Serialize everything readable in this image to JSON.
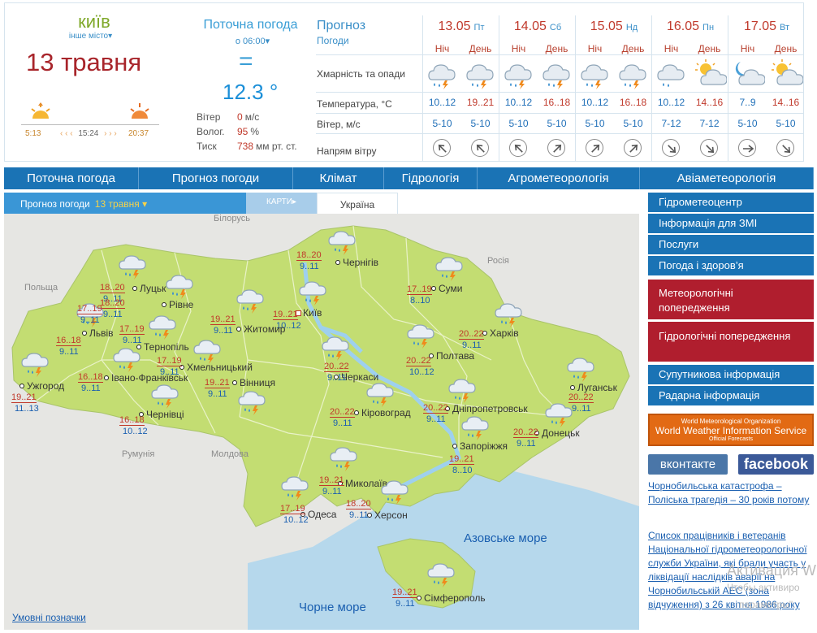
{
  "header": {
    "city": "київ",
    "city_other": "інше місто",
    "date": "13 травня",
    "sunrise": "5:13",
    "sunset": "20:37",
    "day_length": "15:24",
    "current": {
      "title": "Поточна погода",
      "time": "о 06:00",
      "symbol": "=",
      "temp": "12.3 °",
      "wind_label": "Вітер",
      "wind_value": "0",
      "wind_unit": "м/с",
      "hum_label": "Волог.",
      "hum_value": "95",
      "hum_unit": "%",
      "press_label": "Тиск",
      "press_value": "738",
      "press_unit": "мм рт. ст."
    },
    "forecast": {
      "title": "Прогноз",
      "subtitle": "Погоди",
      "row_clouds": "Хмарність та опади",
      "row_temp": "Температура, °С",
      "row_wind": "Вітер, м/с",
      "row_dir": "Напрям вітру",
      "night_label": "Ніч",
      "day_label": "День",
      "days": [
        {
          "date": "13.05",
          "dow": "Пт"
        },
        {
          "date": "14.05",
          "dow": "Сб"
        },
        {
          "date": "15.05",
          "dow": "Нд"
        },
        {
          "date": "16.05",
          "dow": "Пн"
        },
        {
          "date": "17.05",
          "dow": "Вт"
        }
      ],
      "periods": [
        {
          "icon": "rain-thunder-icon",
          "temp": "10..12",
          "wind": "5-10",
          "dir": "nw"
        },
        {
          "icon": "rain-thunder-icon",
          "temp": "19..21",
          "wind": "5-10",
          "dir": "nw"
        },
        {
          "icon": "rain-thunder-icon",
          "temp": "10..12",
          "wind": "5-10",
          "dir": "nw"
        },
        {
          "icon": "rain-thunder-icon",
          "temp": "16..18",
          "wind": "5-10",
          "dir": "ne"
        },
        {
          "icon": "rain-thunder-icon",
          "temp": "10..12",
          "wind": "5-10",
          "dir": "ne"
        },
        {
          "icon": "rain-thunder-icon",
          "temp": "16..18",
          "wind": "5-10",
          "dir": "ne"
        },
        {
          "icon": "rain-icon",
          "temp": "10..12",
          "wind": "7-12",
          "dir": "se"
        },
        {
          "icon": "sun-cloud-icon",
          "temp": "14..16",
          "wind": "7-12",
          "dir": "se"
        },
        {
          "icon": "moon-cloud-icon",
          "temp": "7..9",
          "wind": "5-10",
          "dir": "e"
        },
        {
          "icon": "sun-cloud-icon",
          "temp": "14..16",
          "wind": "5-10",
          "dir": "se"
        }
      ]
    }
  },
  "nav": [
    "Поточна погода",
    "Прогноз погоди",
    "Клімат",
    "Гідрологія",
    "Агрометеорологія",
    "Авіаметеорологія"
  ],
  "map": {
    "tab_forecast": "Прогноз погоди",
    "tab_date": "13 травня",
    "maps_label": "КАРТИ",
    "ukraine_label": "Україна",
    "legend": "Умовні позначки",
    "foreign": [
      "Білорусь",
      "Польща",
      "Росія",
      "Молдова",
      "Румунія"
    ],
    "seas": [
      "Азовське море",
      "Чорне море"
    ],
    "cities": [
      {
        "name": "Чернігів",
        "day": "18..20",
        "night": "9..11",
        "capital": false
      },
      {
        "name": "Луцьк",
        "day": "18..20",
        "night": "9..11",
        "capital": false
      },
      {
        "name": "Рівне",
        "day": "18..20",
        "night": "9..11",
        "capital": false
      },
      {
        "name": "Суми",
        "day": "17..19",
        "night": "8..10",
        "capital": false
      },
      {
        "name": "Київ",
        "day": "19..21",
        "night": "10..12",
        "capital": true
      },
      {
        "name": "Житомир",
        "day": "19..21",
        "night": "9..11",
        "capital": false
      },
      {
        "name": "Львів",
        "day": "17..19",
        "night": "9..11",
        "capital": false
      },
      {
        "name": "Тернопіль",
        "day": "17..19",
        "night": "9..11",
        "capital": false
      },
      {
        "name": "Харків",
        "day": "20..22",
        "night": "9..11",
        "capital": false
      },
      {
        "name": "Хмельницький",
        "day": "17..19",
        "night": "9..11",
        "capital": false
      },
      {
        "name": "Полтава",
        "day": "20..22",
        "night": "10..12",
        "capital": false
      },
      {
        "name": "Ужгород",
        "day": "16..18",
        "night": "9..11",
        "capital": false
      },
      {
        "name": "Івано-Франківськ",
        "day": "16..18",
        "night": "9..11",
        "capital": false
      },
      {
        "name": "Черкаси",
        "day": "20..22",
        "night": "9..11",
        "capital": false
      },
      {
        "name": "Луганськ",
        "day": "20..22",
        "night": "9..11",
        "capital": false
      },
      {
        "name": "Вінниця",
        "day": "19..21",
        "night": "9..11",
        "capital": false
      },
      {
        "name": "Чернівці",
        "day": "19..21",
        "night": "11..13",
        "capital": false
      },
      {
        "name": "Дніпропетровськ",
        "day": "20..22",
        "night": "9..11",
        "capital": false
      },
      {
        "name": "Кіровоград",
        "day": "20..22",
        "night": "9..11",
        "capital": false
      },
      {
        "name": "Донецьк",
        "day": "20..22",
        "night": "9..11",
        "capital": false
      },
      {
        "name": "Запоріжжя",
        "day": "19..21",
        "night": "8..10",
        "capital": false
      },
      {
        "name": "Миколаїв",
        "day": "19..21",
        "night": "9..11",
        "capital": false
      },
      {
        "name": "Херсон",
        "day": "18..20",
        "night": "9..11",
        "capital": false
      },
      {
        "name": "Одеса",
        "day": "17..19",
        "night": "10..12",
        "capital": false
      },
      {
        "name": "Сімферополь",
        "day": "19..21",
        "night": "9..11",
        "capital": false
      },
      {
        "name": "",
        "day": "16..18",
        "night": "10..12",
        "capital": false
      }
    ]
  },
  "sidebar": {
    "buttons": [
      "Гідрометеоцентр",
      "Інформація для ЗМІ",
      "Послуги",
      "Погода і здоров’я"
    ],
    "red_buttons": [
      "Метеорологічні попередження",
      "Гідрологічні попередження"
    ],
    "buttons2": [
      "Супутникова інформація",
      "Радарна інформація"
    ],
    "wmo_l1": "World Meteorological Organization",
    "wmo_l2": "World Weather Information Service",
    "wmo_l3": "Official Forecasts",
    "vk": "вконтакте",
    "fb": "facebook",
    "news": [
      "Чорнобильська катастрофа – Поліська трагедія – 30 років потому",
      "Список працівників і ветеранів Національної гідрометеорологічної служби України, які брали участь у ліквідації наслідків аварії на Чорнобильській АЕС (зона відчуження) з 26 квітня 1986 року"
    ]
  },
  "watermark": {
    "line1": "Активация W",
    "line2": "Чтобы активиро",
    "line3": "параметры\"."
  }
}
